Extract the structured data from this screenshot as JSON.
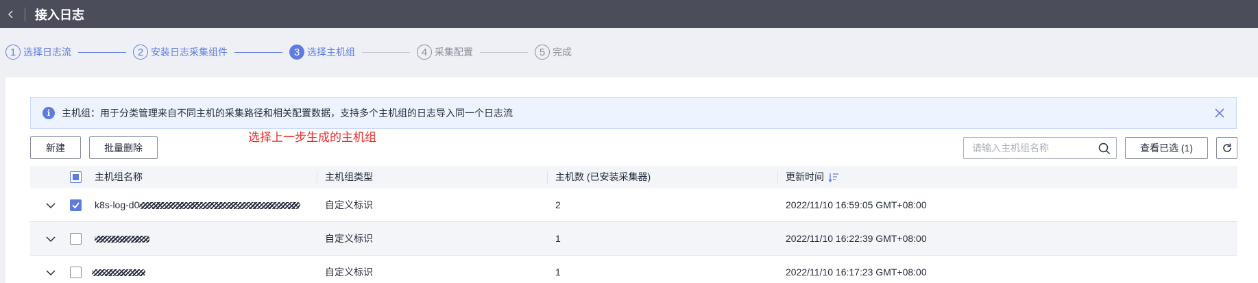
{
  "header": {
    "title": "接入日志"
  },
  "steps": [
    {
      "num": "1",
      "label": "选择日志流"
    },
    {
      "num": "2",
      "label": "安装日志采集组件"
    },
    {
      "num": "3",
      "label": "选择主机组"
    },
    {
      "num": "4",
      "label": "采集配置"
    },
    {
      "num": "5",
      "label": "完成"
    }
  ],
  "notice": {
    "text": "主机组：用于分类管理来自不同主机的采集路径和相关配置数据，支持多个主机组的日志导入同一个日志流"
  },
  "annotation": "选择上一步生成的主机组",
  "toolbar": {
    "create_label": "新建",
    "batch_delete_label": "批量删除",
    "search_placeholder": "请输入主机组名称",
    "view_selected_label": "查看已选 (1)"
  },
  "table": {
    "columns": [
      "主机组名称",
      "主机组类型",
      "主机数 (已安装采集器)",
      "更新时间"
    ],
    "rows": [
      {
        "name": "k8s-log-d0",
        "type": "自定义标识",
        "count": "2",
        "updated": "2022/11/10 16:59:05 GMT+08:00",
        "checked": true
      },
      {
        "name": "",
        "type": "自定义标识",
        "count": "1",
        "updated": "2022/11/10 16:22:39 GMT+08:00",
        "checked": false
      },
      {
        "name": "",
        "type": "自定义标识",
        "count": "1",
        "updated": "2022/11/10 16:17:23 GMT+08:00",
        "checked": false
      }
    ]
  },
  "colors": {
    "accent": "#5e7ce0",
    "header_bg": "#4b4e5a",
    "annotation": "#ee2b2b"
  }
}
